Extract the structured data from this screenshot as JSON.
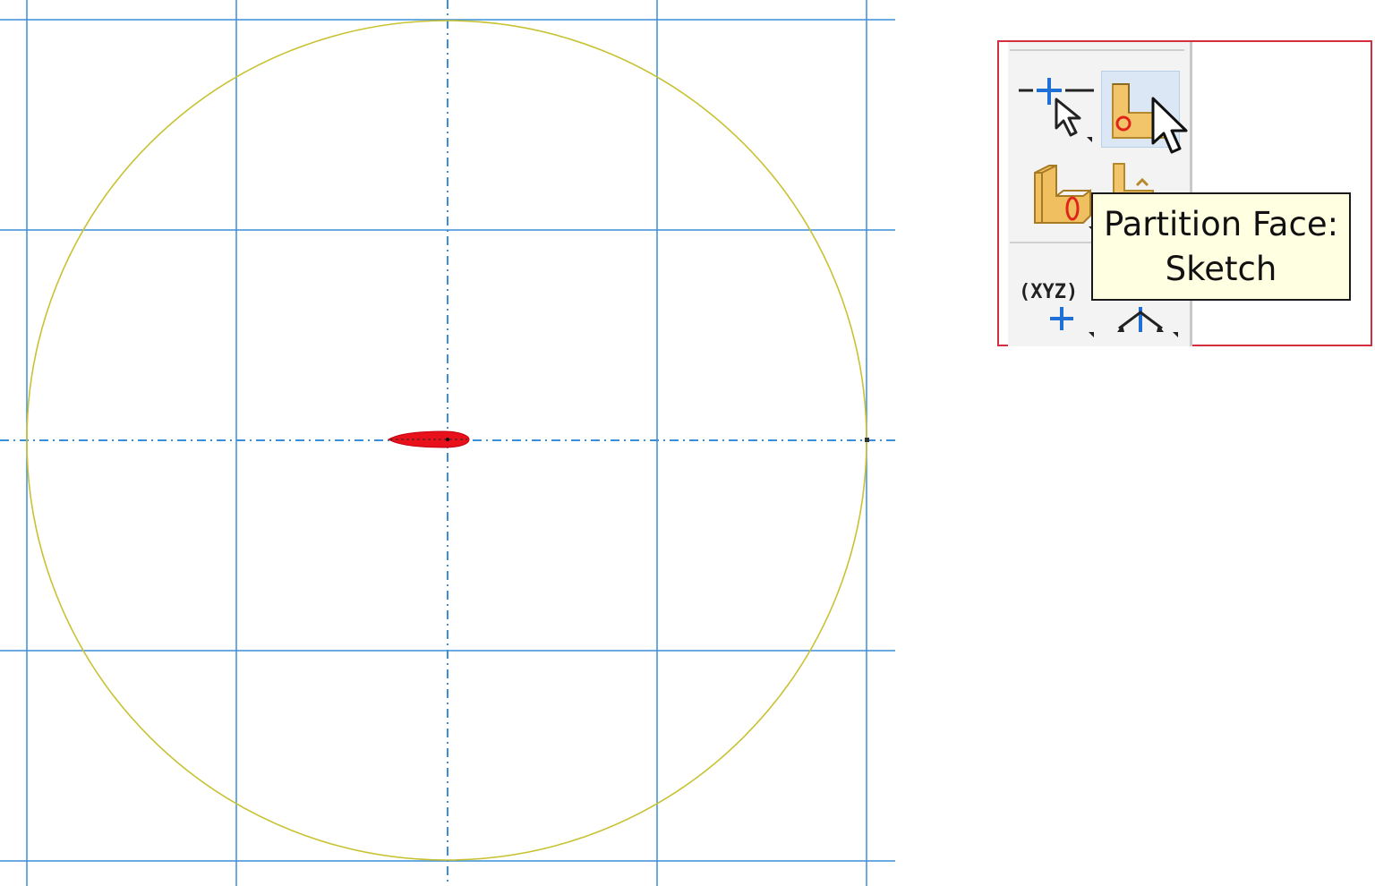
{
  "tooltip": {
    "line1": "Partition Face:",
    "line2": "Sketch"
  },
  "toolbox": {
    "tools": [
      {
        "name": "create-datum-point-tool",
        "icon": "datum-point-cursor-icon",
        "active": false
      },
      {
        "name": "partition-face-sketch-tool",
        "icon": "partition-face-icon",
        "active": true
      },
      {
        "name": "partition-cell-tool",
        "icon": "partition-cell-icon",
        "active": false
      },
      {
        "name": "partition-edge-tool",
        "icon": "partition-edge-icon",
        "active": false
      },
      {
        "name": "datum-point-xyz-tool",
        "icon": "datum-xyz-icon",
        "label": "(XYZ)",
        "active": false
      },
      {
        "name": "datum-axis-tool",
        "icon": "datum-axis-icon",
        "active": false
      }
    ]
  },
  "colors": {
    "grid": "#3b8fd9",
    "circle": "#c8c232",
    "airfoil": "#e8101a",
    "highlight_box": "#d3303f",
    "tooltip_bg": "#ffffe1"
  }
}
